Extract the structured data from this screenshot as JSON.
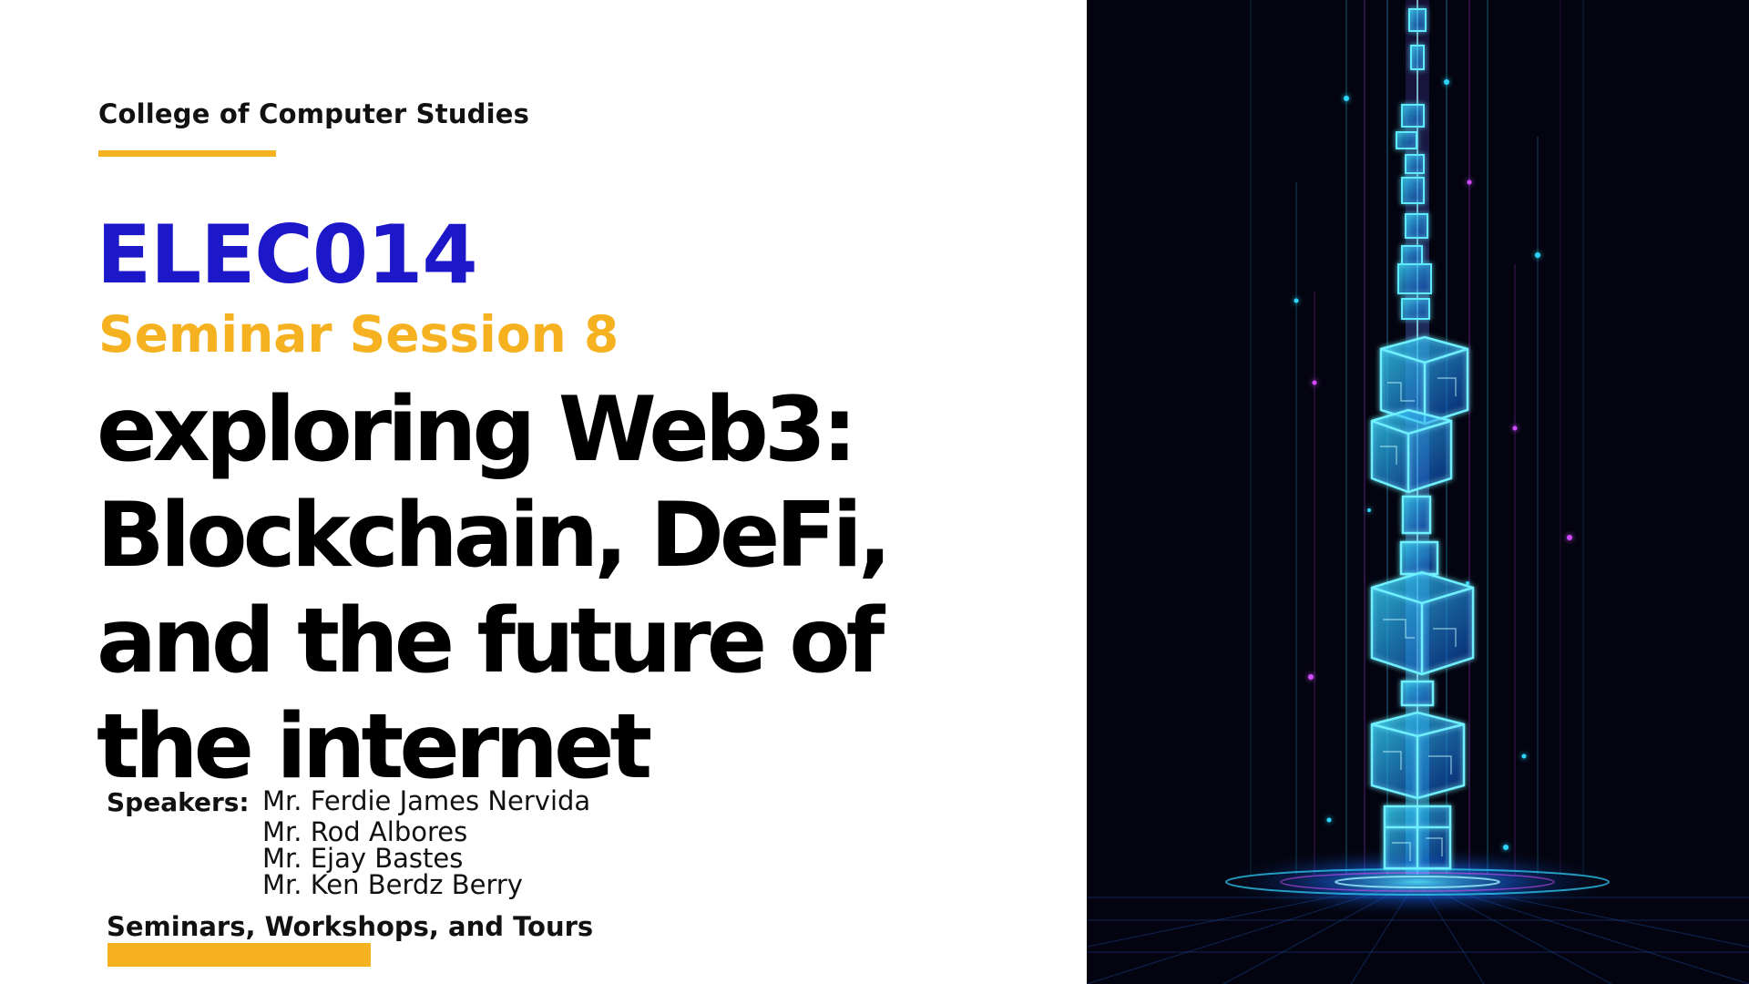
{
  "slide": {
    "department": "College of Computer Studies",
    "course_code": "ELEC014",
    "session": "Seminar Session 8",
    "title_lines": [
      "exploring Web3:",
      "Blockchain, DeFi,",
      "and the future of",
      "the internet"
    ],
    "speakers_label": "Speakers:",
    "speakers": [
      "Mr. Ferdie James Nervida",
      "Mr. Rod Albores",
      "Mr. Ejay Bastes",
      "Mr. Ken Berdz Berry"
    ],
    "series": "Seminars, Workshops, and Tours"
  },
  "colors": {
    "accent_yellow": "#f5b120",
    "code_blue": "#1c17c8",
    "text_black": "#000000",
    "art_background": "#03040f",
    "art_glow_cyan": "#2fd6ff",
    "art_glow_magenta": "#d24cff"
  },
  "illustration": {
    "subject": "glowing-blockchain-cube-tower"
  }
}
